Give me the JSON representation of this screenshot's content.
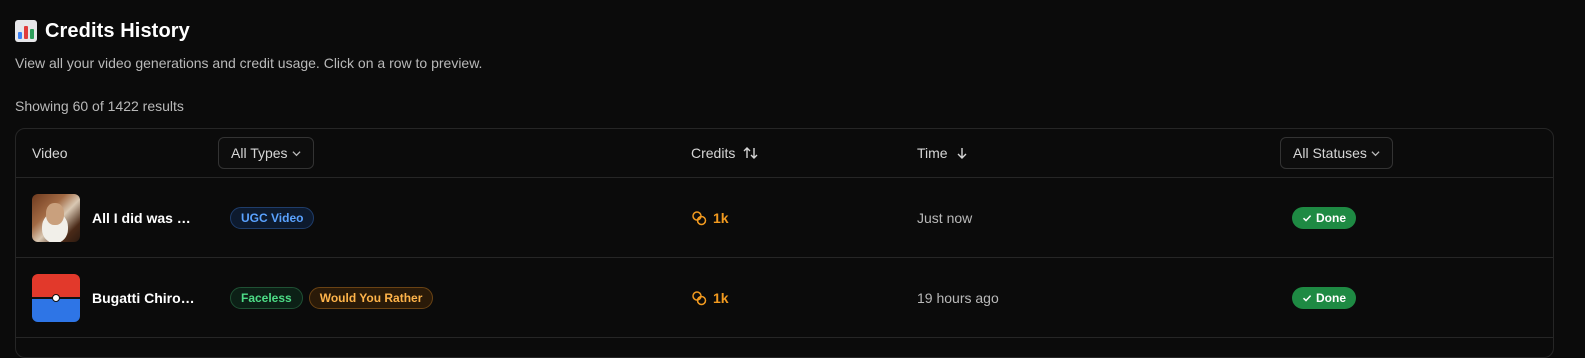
{
  "header": {
    "icon": "bar-chart-icon",
    "title": "Credits History",
    "subtitle": "View all your video generations and credit usage. Click on a row to preview.",
    "results_text": "Showing 60 of 1422 results"
  },
  "table": {
    "columns": {
      "video": "Video",
      "types_filter": "All Types",
      "credits": "Credits",
      "time": "Time",
      "status_filter": "All Statuses"
    },
    "rows": [
      {
        "title": "All I did was wr...",
        "thumbnail": "person-photo",
        "tags": [
          {
            "label": "UGC Video",
            "color": "blue"
          }
        ],
        "credits": "1k",
        "time": "Just now",
        "status": "Done"
      },
      {
        "title": "Bugatti Chiron ...",
        "thumbnail": "pokeball",
        "tags": [
          {
            "label": "Faceless",
            "color": "green"
          },
          {
            "label": "Would You Rather",
            "color": "orange"
          }
        ],
        "credits": "1k",
        "time": "19 hours ago",
        "status": "Done"
      }
    ]
  },
  "colors": {
    "background": "#0b0b0b",
    "credits_accent": "#f29a1f",
    "done_badge": "#1e8a43",
    "tag_blue": "#5aa2ff",
    "tag_green": "#4ddc86",
    "tag_orange": "#ffb44a"
  }
}
